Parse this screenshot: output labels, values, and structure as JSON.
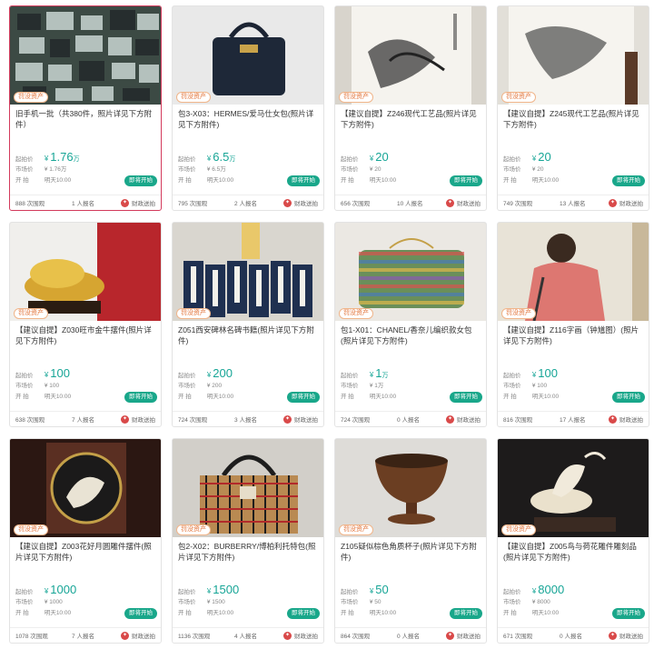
{
  "labels": {
    "start_price": "起拍价",
    "market_price": "市场价",
    "auction_start": "开  拍",
    "start_button": "即将开始",
    "views_suffix": "次围观",
    "signup_suffix": "人报名",
    "fiscal": "财政送拍",
    "badge": "罚没资产",
    "currency": "¥"
  },
  "items": [
    {
      "title": "旧手机一批（共380件，照片详见下方附件）",
      "price": "1.76",
      "unit": "万",
      "market": "¥ 1.76万",
      "time": "明天10:00",
      "views": "888",
      "signup": "1"
    },
    {
      "title": "包3-X03：HERMES/爱马仕女包(照片详见下方附件)",
      "price": "6.5",
      "unit": "万",
      "market": "¥ 6.5万",
      "time": "明天10:00",
      "views": "795",
      "signup": "2"
    },
    {
      "title": "【建议自提】Z246现代工艺品(照片详见下方附件)",
      "price": "20",
      "unit": "",
      "market": "¥ 20",
      "time": "明天10:00",
      "views": "656",
      "signup": "10"
    },
    {
      "title": "【建议自提】Z245现代工艺品(照片详见下方附件)",
      "price": "20",
      "unit": "",
      "market": "¥ 20",
      "time": "明天10:00",
      "views": "749",
      "signup": "13"
    },
    {
      "title": "【建议自提】Z030旺市金牛摆件(照片详见下方附件)",
      "price": "100",
      "unit": "",
      "market": "¥ 100",
      "time": "明天10:00",
      "views": "638",
      "signup": "7"
    },
    {
      "title": "Z051西安碑林名碑书籍(照片详见下方附件)",
      "price": "200",
      "unit": "",
      "market": "¥ 200",
      "time": "明天10:00",
      "views": "724",
      "signup": "3"
    },
    {
      "title": "包1-X01：CHANEL/香奈儿编织款女包(照片详见下方附件)",
      "price": "1",
      "unit": "万",
      "market": "¥ 1万",
      "time": "明天10:00",
      "views": "724",
      "signup": "0"
    },
    {
      "title": "【建议自提】Z116字画（钟馗图）(照片详见下方附件)",
      "price": "100",
      "unit": "",
      "market": "¥ 100",
      "time": "明天10:00",
      "views": "816",
      "signup": "17"
    },
    {
      "title": "【建议自提】Z003花好月圆雕件摆件(照片详见下方附件)",
      "price": "1000",
      "unit": "",
      "market": "¥ 1000",
      "time": "明天10:00",
      "views": "1078",
      "signup": "7"
    },
    {
      "title": "包2-X02：BURBERRY/博柏利托特包(照片详见下方附件)",
      "price": "1500",
      "unit": "",
      "market": "¥ 1500",
      "time": "明天10:00",
      "views": "1136",
      "signup": "4"
    },
    {
      "title": "Z105疑似棕色角质杯子(照片详见下方附件)",
      "price": "50",
      "unit": "",
      "market": "¥ 50",
      "time": "明天10:00",
      "views": "864",
      "signup": "0"
    },
    {
      "title": "【建议自提】Z005鸟与荷花雕件雕刻品(照片详见下方附件)",
      "price": "8000",
      "unit": "",
      "market": "¥ 8000",
      "time": "明天10:00",
      "views": "671",
      "signup": "0"
    }
  ]
}
